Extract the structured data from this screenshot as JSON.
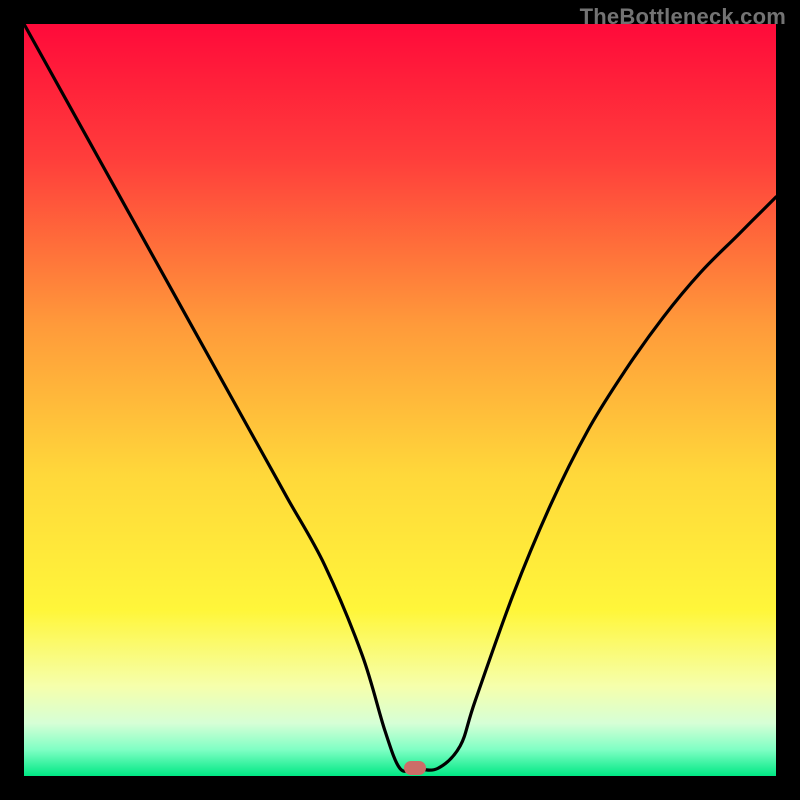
{
  "watermark": "TheBottleneck.com",
  "chart_data": {
    "type": "line",
    "title": "",
    "xlabel": "",
    "ylabel": "",
    "xlim": [
      0,
      100
    ],
    "ylim": [
      0,
      100
    ],
    "gradient_stops": [
      {
        "pos": 0.0,
        "color": "#ff0a3a"
      },
      {
        "pos": 0.18,
        "color": "#ff3e3b"
      },
      {
        "pos": 0.4,
        "color": "#ff9a3a"
      },
      {
        "pos": 0.6,
        "color": "#ffd83a"
      },
      {
        "pos": 0.78,
        "color": "#fff63a"
      },
      {
        "pos": 0.88,
        "color": "#f6ffab"
      },
      {
        "pos": 0.93,
        "color": "#d6ffd6"
      },
      {
        "pos": 0.965,
        "color": "#7fffc4"
      },
      {
        "pos": 1.0,
        "color": "#00e884"
      }
    ],
    "series": [
      {
        "name": "bottleneck-curve",
        "x": [
          0,
          5,
          10,
          15,
          20,
          25,
          30,
          35,
          40,
          45,
          48,
          50,
          52,
          55,
          58,
          60,
          65,
          70,
          75,
          80,
          85,
          90,
          95,
          100
        ],
        "y": [
          100,
          91,
          82,
          73,
          64,
          55,
          46,
          37,
          28,
          16,
          6,
          1,
          1,
          1,
          4,
          10,
          24,
          36,
          46,
          54,
          61,
          67,
          72,
          77
        ]
      }
    ],
    "marker": {
      "x": 52,
      "y": 1
    }
  }
}
